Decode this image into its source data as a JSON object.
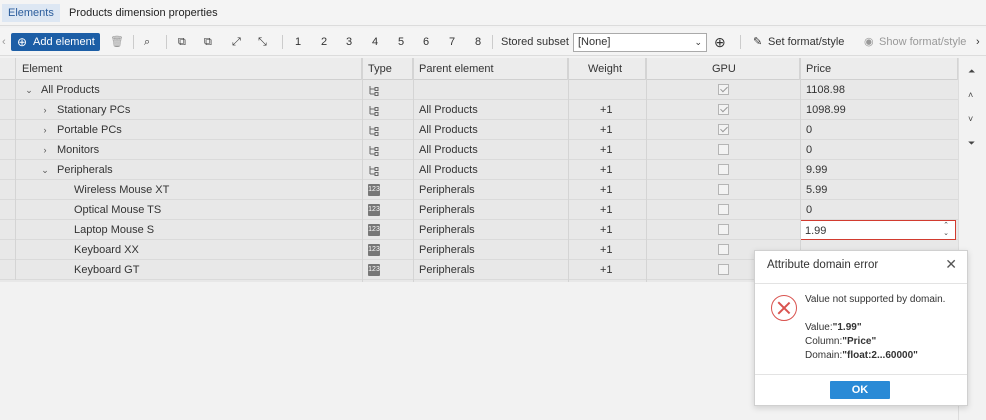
{
  "tabs": [
    {
      "label": "Elements",
      "active": true
    },
    {
      "label": "Products dimension properties",
      "active": false
    }
  ],
  "toolbar": {
    "add_element": "Add element",
    "level_numbers": [
      "1",
      "2",
      "3",
      "4",
      "5",
      "6",
      "7",
      "8"
    ],
    "stored_subset_label": "Stored subset",
    "stored_subset_value": "[None]",
    "set_format_style": "Set format/style",
    "show_format_style": "Show format/style"
  },
  "grid": {
    "columns": [
      "Element",
      "Type",
      "Parent element",
      "Weight",
      "GPU",
      "Price"
    ],
    "rows": [
      {
        "element": "All Products",
        "level": 0,
        "expander": "collapse",
        "type": "consolidated",
        "parent": "",
        "weight": "",
        "gpu": true,
        "price": "1108.98"
      },
      {
        "element": "Stationary PCs",
        "level": 1,
        "expander": "expand",
        "type": "consolidated",
        "parent": "All Products",
        "weight": "+1",
        "gpu": true,
        "price": "1098.99"
      },
      {
        "element": "Portable PCs",
        "level": 1,
        "expander": "expand",
        "type": "consolidated",
        "parent": "All Products",
        "weight": "+1",
        "gpu": true,
        "price": "0"
      },
      {
        "element": "Monitors",
        "level": 1,
        "expander": "expand",
        "type": "consolidated",
        "parent": "All Products",
        "weight": "+1",
        "gpu": false,
        "price": "0"
      },
      {
        "element": "Peripherals",
        "level": 1,
        "expander": "collapse",
        "type": "consolidated",
        "parent": "All Products",
        "weight": "+1",
        "gpu": false,
        "price": "9.99"
      },
      {
        "element": "Wireless Mouse XT",
        "level": 2,
        "expander": "",
        "type": "numeric",
        "parent": "Peripherals",
        "weight": "+1",
        "gpu": false,
        "price": "5.99"
      },
      {
        "element": "Optical Mouse TS",
        "level": 2,
        "expander": "",
        "type": "numeric",
        "parent": "Peripherals",
        "weight": "+1",
        "gpu": false,
        "price": "0"
      },
      {
        "element": "Laptop Mouse S",
        "level": 2,
        "expander": "",
        "type": "numeric",
        "parent": "Peripherals",
        "weight": "+1",
        "gpu": false,
        "price": "1.99"
      },
      {
        "element": "Keyboard XX",
        "level": 2,
        "expander": "",
        "type": "numeric",
        "parent": "Peripherals",
        "weight": "+1",
        "gpu": false,
        "price": ""
      },
      {
        "element": "Keyboard GT",
        "level": 2,
        "expander": "",
        "type": "numeric",
        "parent": "Peripherals",
        "weight": "+1",
        "gpu": false,
        "price": ""
      }
    ],
    "type_icon_numeric_text": "123"
  },
  "dialog": {
    "title": "Attribute domain error",
    "message": "Value not supported by domain.",
    "value_label": "Value:",
    "value": "\"1.99\"",
    "column_label": "Column:",
    "column": "\"Price\"",
    "domain_label": "Domain:",
    "domain": "\"float:2...60000\"",
    "ok_label": "OK"
  },
  "colors": {
    "accent": "#1c5ea6",
    "error": "#d23b2f",
    "ok_button": "#2a8ad6"
  }
}
